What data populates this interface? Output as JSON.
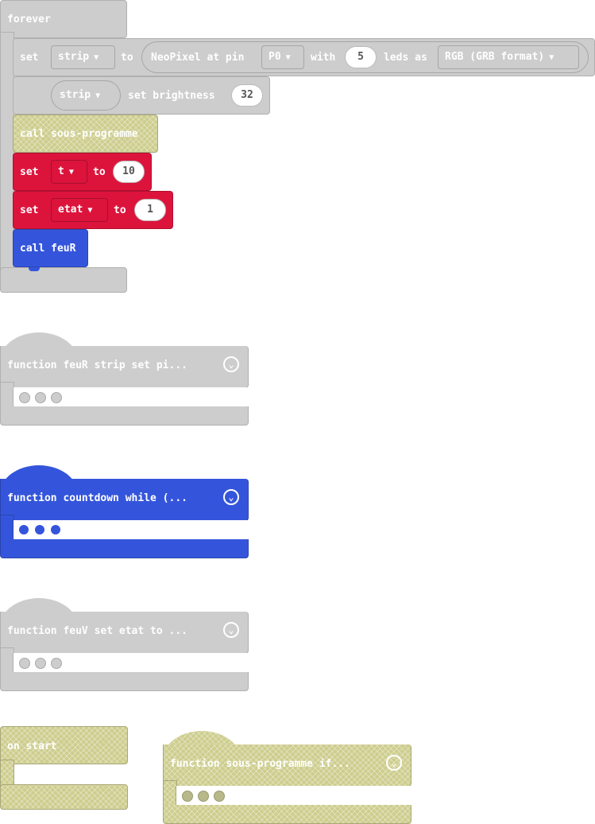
{
  "forever_block": {
    "label": "forever",
    "set_strip": {
      "set": "set",
      "var": "strip",
      "to": "to",
      "neopixel": "NeoPixel at pin",
      "pin": "P0",
      "with": "with",
      "count": "5",
      "leds_as": "leds as",
      "format": "RGB (GRB format)"
    },
    "brightness": {
      "var": "strip",
      "label": "set brightness",
      "value": "32"
    },
    "call_sous": "call sous-programme",
    "set_t": {
      "set": "set",
      "var": "t",
      "to": "to",
      "value": "10"
    },
    "set_etat": {
      "set": "set",
      "var": "etat",
      "to": "to",
      "value": "1"
    },
    "call_feur": "call feuR"
  },
  "functions": [
    {
      "label": "function feuR  strip set pi..."
    },
    {
      "label": "function countdown  while (..."
    },
    {
      "label": "function feuV  set etat to ..."
    },
    {
      "label": "function sous-programme  if..."
    }
  ],
  "on_start": {
    "label": "on start"
  },
  "icons": {
    "expand": "chevron-down-icon",
    "collapsed": "ellipsis-dots-icon"
  },
  "colors": {
    "control": "#cdcdcd",
    "variables": "#dc143c",
    "functions": "#3455db",
    "disabled": "#cdcd8e"
  }
}
